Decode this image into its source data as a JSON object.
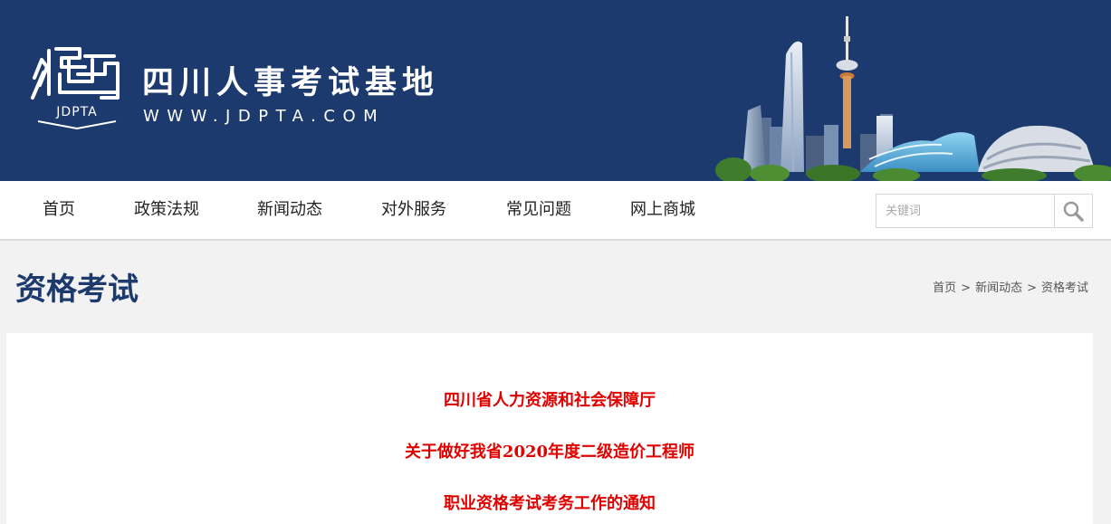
{
  "header": {
    "logo_text": "JDPTA",
    "site_name": "四川人事考试基地",
    "site_url": "WWW.JDPTA.COM",
    "background_color": "#1d3a6e"
  },
  "nav": {
    "items": [
      {
        "label": "首页"
      },
      {
        "label": "政策法规"
      },
      {
        "label": "新闻动态"
      },
      {
        "label": "对外服务"
      },
      {
        "label": "常见问题"
      },
      {
        "label": "网上商城"
      }
    ],
    "search": {
      "placeholder": "关键词",
      "icon": "search-icon"
    }
  },
  "page": {
    "title": "资格考试",
    "title_color": "#1d3a6e",
    "breadcrumb": [
      "首页",
      "新闻动态",
      "资格考试"
    ],
    "breadcrumb_separator": ">"
  },
  "article": {
    "color": "#e00000",
    "lines": [
      "四川省人力资源和社会保障厅",
      "关于做好我省2020年度二级造价工程师",
      "职业资格考试考务工作的通知"
    ]
  }
}
